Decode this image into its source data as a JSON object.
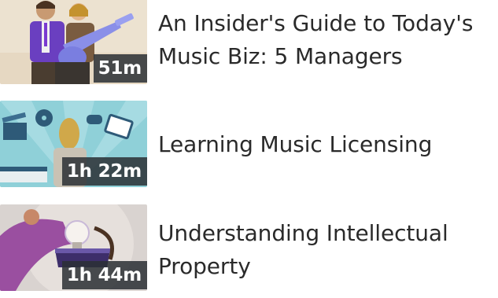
{
  "courses": [
    {
      "title": "An Insider's Guide to Today's Music Biz: 5 Managers",
      "duration": "51m",
      "thumbnail_icon": "music-managers-illustration"
    },
    {
      "title": "Learning Music Licensing",
      "duration": "1h 22m",
      "thumbnail_icon": "music-licensing-illustration"
    },
    {
      "title": "Understanding Intellectual Property",
      "duration": "1h 44m",
      "thumbnail_icon": "intellectual-property-illustration"
    }
  ],
  "colors": {
    "title_text": "#2a2a2a",
    "duration_badge_bg": "#2b3034",
    "duration_badge_text": "#ffffff"
  }
}
